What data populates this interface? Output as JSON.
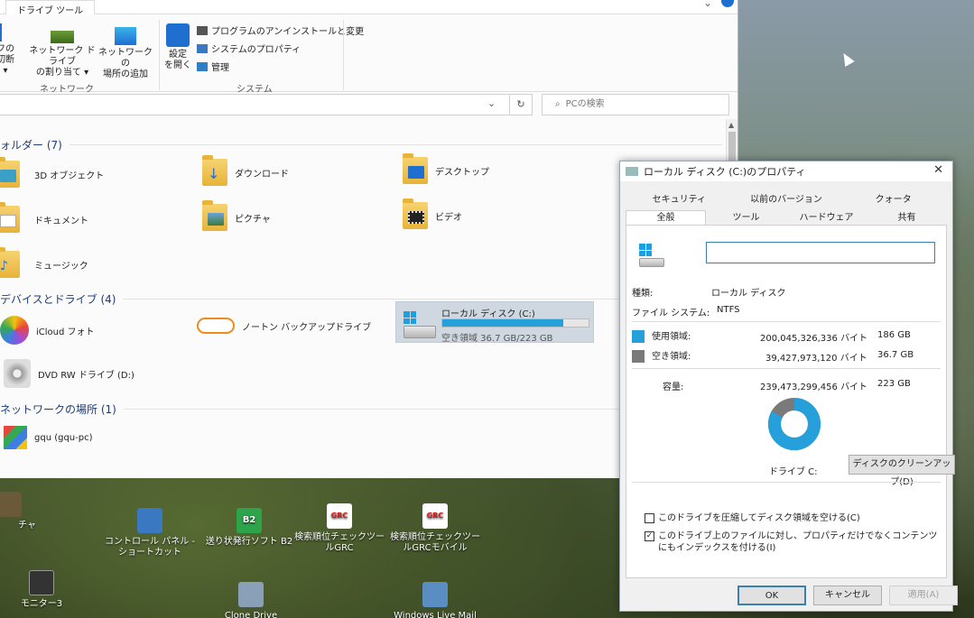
{
  "explorer": {
    "ribbon_tab": "ドライブ ツール",
    "ribbon": {
      "map_drive_1": "ネットワーク ドライブ",
      "map_drive_2": "の割り当て ▾",
      "add_location_1": "ネットワークの",
      "add_location_2": "場所の追加",
      "disconnect_1": "フの",
      "disconnect_2": "切断 ▾",
      "network_group": "ネットワーク",
      "open_settings_1": "設定",
      "open_settings_2": "を開く",
      "uninstall": "プログラムのアンインストールと変更",
      "system_properties": "システムのプロパティ",
      "manage": "管理",
      "system_group": "システム"
    },
    "search_placeholder": "PCの検索",
    "sections": {
      "folders": "ォルダー (7)",
      "devices": "デバイスとドライブ (4)",
      "network": "ネットワークの場所 (1)"
    },
    "folders": [
      {
        "label": "3D オブジェクト"
      },
      {
        "label": "ダウンロード"
      },
      {
        "label": "デスクトップ"
      },
      {
        "label": "ドキュメント"
      },
      {
        "label": "ピクチャ"
      },
      {
        "label": "ビデオ"
      },
      {
        "label": "ミュージック"
      }
    ],
    "devices": {
      "icloud": "iCloud フォト",
      "norton": "ノートン バックアップドライブ",
      "local_disk_name": "ローカル ディスク (C:)",
      "local_disk_free": "空き領域 36.7 GB/223 GB",
      "local_disk_used_fraction": 0.83,
      "dvd": "DVD RW ドライブ (D:)"
    },
    "network_items": [
      {
        "label": "gqu (gqu-pc)"
      }
    ]
  },
  "desktop": {
    "icons": [
      {
        "label": "チャ"
      },
      {
        "label": "コントロール パネル - ショートカット"
      },
      {
        "label": "送り状発行ソフト B2"
      },
      {
        "label": "検索順位チェックツー ルGRC"
      },
      {
        "label": "検索順位チェックツー ルGRCモバイル"
      },
      {
        "label": "モニター3"
      },
      {
        "label": "Clone Drive"
      },
      {
        "label": "Windows Live Mail"
      }
    ],
    "b2_glyph": "B2",
    "grc_glyph": "GRC"
  },
  "dialog": {
    "title": "ローカル ディスク (C:)のプロパティ",
    "tabs_back": [
      "セキュリティ",
      "以前のバージョン",
      "クォータ"
    ],
    "tabs_front": [
      "全般",
      "ツール",
      "ハードウェア",
      "共有"
    ],
    "type_label": "種類:",
    "type_value": "ローカル ディスク",
    "fs_label": "ファイル システム:",
    "fs_value": "NTFS",
    "used_label": "使用領域:",
    "used_bytes": "200,045,326,336 バイト",
    "used_gb": "186 GB",
    "free_label": "空き領域:",
    "free_bytes": "39,427,973,120 バイト",
    "free_gb": "36.7 GB",
    "capacity_label": "容量:",
    "capacity_bytes": "239,473,299,456 バイト",
    "capacity_gb": "223 GB",
    "drive_label": "ドライブ C:",
    "cleanup": "ディスクのクリーンアップ(D)",
    "compress": "このドライブを圧縮してディスク領域を空ける(C)",
    "index": "このドライブ上のファイルに対し、プロパティだけでなくコンテンツにもインデックスを付ける(I)",
    "compress_checked": false,
    "index_checked": true,
    "ok": "OK",
    "cancel": "キャンセル",
    "apply": "適用(A)",
    "colors": {
      "used": "#26a0da",
      "free": "#7a7a7a"
    }
  }
}
